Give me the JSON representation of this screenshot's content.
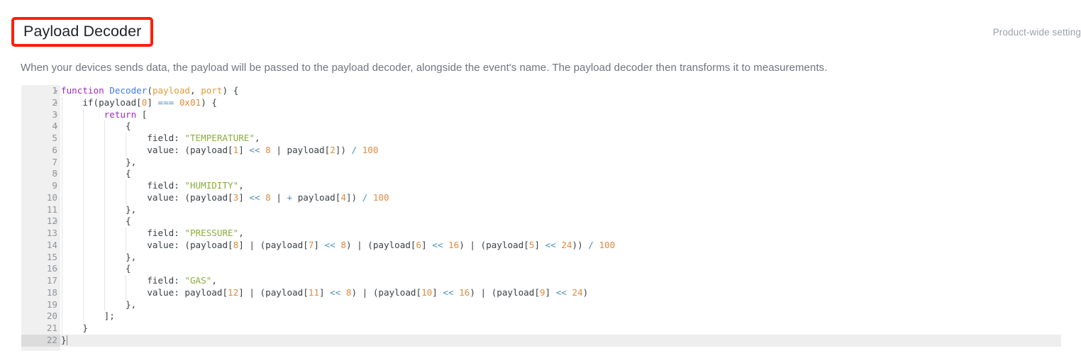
{
  "header": {
    "title": "Payload Decoder",
    "right_label": "Product-wide setting",
    "highlight_color": "#fb1f0d"
  },
  "description": "When your devices sends data, the payload will be passed to the payload decoder, alongside the event's name. The payload decoder then transforms it to measurements.",
  "editor": {
    "language": "javascript",
    "active_line": 22,
    "total_lines": 22,
    "fold_lines": [
      1,
      2,
      3,
      4,
      8,
      12,
      16
    ],
    "theme": {
      "gutter_bg": "#f0f0f0",
      "active_line_bg": "#eeeeee",
      "keyword": "#a626c4",
      "function": "#4078f2",
      "parameter": "#e09b3a",
      "number": "#e08a3c",
      "string": "#8aad3a",
      "operator": "#4a90b8",
      "plain": "#3b4045"
    },
    "lines": [
      {
        "n": 1,
        "fold": true,
        "indent": 0,
        "tokens": [
          {
            "t": "function",
            "c": "kw"
          },
          {
            "t": " ",
            "c": "pl"
          },
          {
            "t": "Decoder",
            "c": "fn"
          },
          {
            "t": "(",
            "c": "pl"
          },
          {
            "t": "payload",
            "c": "par"
          },
          {
            "t": ", ",
            "c": "pl"
          },
          {
            "t": "port",
            "c": "par"
          },
          {
            "t": ") {",
            "c": "pl"
          }
        ]
      },
      {
        "n": 2,
        "fold": true,
        "indent": 1,
        "tokens": [
          {
            "t": "    if(payload[",
            "c": "pl"
          },
          {
            "t": "0",
            "c": "num"
          },
          {
            "t": "] ",
            "c": "pl"
          },
          {
            "t": "===",
            "c": "op"
          },
          {
            "t": " ",
            "c": "pl"
          },
          {
            "t": "0x01",
            "c": "num"
          },
          {
            "t": ") {",
            "c": "pl"
          }
        ]
      },
      {
        "n": 3,
        "fold": true,
        "indent": 2,
        "tokens": [
          {
            "t": "        ",
            "c": "pl"
          },
          {
            "t": "return",
            "c": "kw"
          },
          {
            "t": " [",
            "c": "pl"
          }
        ]
      },
      {
        "n": 4,
        "fold": true,
        "indent": 3,
        "tokens": [
          {
            "t": "            {",
            "c": "pl"
          }
        ]
      },
      {
        "n": 5,
        "fold": false,
        "indent": 4,
        "tokens": [
          {
            "t": "                field: ",
            "c": "pl"
          },
          {
            "t": "\"TEMPERATURE\"",
            "c": "str"
          },
          {
            "t": ",",
            "c": "pl"
          }
        ]
      },
      {
        "n": 6,
        "fold": false,
        "indent": 4,
        "tokens": [
          {
            "t": "                value: (payload[",
            "c": "pl"
          },
          {
            "t": "1",
            "c": "num"
          },
          {
            "t": "] ",
            "c": "pl"
          },
          {
            "t": "<<",
            "c": "op"
          },
          {
            "t": " ",
            "c": "pl"
          },
          {
            "t": "8",
            "c": "num"
          },
          {
            "t": " | payload[",
            "c": "pl"
          },
          {
            "t": "2",
            "c": "num"
          },
          {
            "t": "]) ",
            "c": "pl"
          },
          {
            "t": "/",
            "c": "op"
          },
          {
            "t": " ",
            "c": "pl"
          },
          {
            "t": "100",
            "c": "num"
          }
        ]
      },
      {
        "n": 7,
        "fold": false,
        "indent": 3,
        "tokens": [
          {
            "t": "            },",
            "c": "pl"
          }
        ]
      },
      {
        "n": 8,
        "fold": true,
        "indent": 3,
        "tokens": [
          {
            "t": "            {",
            "c": "pl"
          }
        ]
      },
      {
        "n": 9,
        "fold": false,
        "indent": 4,
        "tokens": [
          {
            "t": "                field: ",
            "c": "pl"
          },
          {
            "t": "\"HUMIDITY\"",
            "c": "str"
          },
          {
            "t": ",",
            "c": "pl"
          }
        ]
      },
      {
        "n": 10,
        "fold": false,
        "indent": 4,
        "tokens": [
          {
            "t": "                value: (payload[",
            "c": "pl"
          },
          {
            "t": "3",
            "c": "num"
          },
          {
            "t": "] ",
            "c": "pl"
          },
          {
            "t": "<<",
            "c": "op"
          },
          {
            "t": " ",
            "c": "pl"
          },
          {
            "t": "8",
            "c": "num"
          },
          {
            "t": " | ",
            "c": "pl"
          },
          {
            "t": "+",
            "c": "op"
          },
          {
            "t": " payload[",
            "c": "pl"
          },
          {
            "t": "4",
            "c": "num"
          },
          {
            "t": "]) ",
            "c": "pl"
          },
          {
            "t": "/",
            "c": "op"
          },
          {
            "t": " ",
            "c": "pl"
          },
          {
            "t": "100",
            "c": "num"
          }
        ]
      },
      {
        "n": 11,
        "fold": false,
        "indent": 3,
        "tokens": [
          {
            "t": "            },",
            "c": "pl"
          }
        ]
      },
      {
        "n": 12,
        "fold": true,
        "indent": 3,
        "tokens": [
          {
            "t": "            {",
            "c": "pl"
          }
        ]
      },
      {
        "n": 13,
        "fold": false,
        "indent": 4,
        "tokens": [
          {
            "t": "                field: ",
            "c": "pl"
          },
          {
            "t": "\"PRESSURE\"",
            "c": "str"
          },
          {
            "t": ",",
            "c": "pl"
          }
        ]
      },
      {
        "n": 14,
        "fold": false,
        "indent": 4,
        "tokens": [
          {
            "t": "                value: (payload[",
            "c": "pl"
          },
          {
            "t": "8",
            "c": "num"
          },
          {
            "t": "] | (payload[",
            "c": "pl"
          },
          {
            "t": "7",
            "c": "num"
          },
          {
            "t": "] ",
            "c": "pl"
          },
          {
            "t": "<<",
            "c": "op"
          },
          {
            "t": " ",
            "c": "pl"
          },
          {
            "t": "8",
            "c": "num"
          },
          {
            "t": ") | (payload[",
            "c": "pl"
          },
          {
            "t": "6",
            "c": "num"
          },
          {
            "t": "] ",
            "c": "pl"
          },
          {
            "t": "<<",
            "c": "op"
          },
          {
            "t": " ",
            "c": "pl"
          },
          {
            "t": "16",
            "c": "num"
          },
          {
            "t": ") | (payload[",
            "c": "pl"
          },
          {
            "t": "5",
            "c": "num"
          },
          {
            "t": "] ",
            "c": "pl"
          },
          {
            "t": "<<",
            "c": "op"
          },
          {
            "t": " ",
            "c": "pl"
          },
          {
            "t": "24",
            "c": "num"
          },
          {
            "t": ")) ",
            "c": "pl"
          },
          {
            "t": "/",
            "c": "op"
          },
          {
            "t": " ",
            "c": "pl"
          },
          {
            "t": "100",
            "c": "num"
          }
        ]
      },
      {
        "n": 15,
        "fold": false,
        "indent": 3,
        "tokens": [
          {
            "t": "            },",
            "c": "pl"
          }
        ]
      },
      {
        "n": 16,
        "fold": true,
        "indent": 3,
        "tokens": [
          {
            "t": "            {",
            "c": "pl"
          }
        ]
      },
      {
        "n": 17,
        "fold": false,
        "indent": 4,
        "tokens": [
          {
            "t": "                field: ",
            "c": "pl"
          },
          {
            "t": "\"GAS\"",
            "c": "str"
          },
          {
            "t": ",",
            "c": "pl"
          }
        ]
      },
      {
        "n": 18,
        "fold": false,
        "indent": 4,
        "tokens": [
          {
            "t": "                value: payload[",
            "c": "pl"
          },
          {
            "t": "12",
            "c": "num"
          },
          {
            "t": "] | (payload[",
            "c": "pl"
          },
          {
            "t": "11",
            "c": "num"
          },
          {
            "t": "] ",
            "c": "pl"
          },
          {
            "t": "<<",
            "c": "op"
          },
          {
            "t": " ",
            "c": "pl"
          },
          {
            "t": "8",
            "c": "num"
          },
          {
            "t": ") | (payload[",
            "c": "pl"
          },
          {
            "t": "10",
            "c": "num"
          },
          {
            "t": "] ",
            "c": "pl"
          },
          {
            "t": "<<",
            "c": "op"
          },
          {
            "t": " ",
            "c": "pl"
          },
          {
            "t": "16",
            "c": "num"
          },
          {
            "t": ") | (payload[",
            "c": "pl"
          },
          {
            "t": "9",
            "c": "num"
          },
          {
            "t": "] ",
            "c": "pl"
          },
          {
            "t": "<<",
            "c": "op"
          },
          {
            "t": " ",
            "c": "pl"
          },
          {
            "t": "24",
            "c": "num"
          },
          {
            "t": ")",
            "c": "pl"
          }
        ]
      },
      {
        "n": 19,
        "fold": false,
        "indent": 3,
        "tokens": [
          {
            "t": "            },",
            "c": "pl"
          }
        ]
      },
      {
        "n": 20,
        "fold": false,
        "indent": 2,
        "tokens": [
          {
            "t": "        ];",
            "c": "pl"
          }
        ]
      },
      {
        "n": 21,
        "fold": false,
        "indent": 1,
        "tokens": [
          {
            "t": "    }",
            "c": "pl"
          }
        ]
      },
      {
        "n": 22,
        "fold": false,
        "indent": 0,
        "tokens": [
          {
            "t": "}",
            "c": "pl"
          }
        ]
      }
    ]
  },
  "icons": {
    "fold_arrow": "▾"
  }
}
